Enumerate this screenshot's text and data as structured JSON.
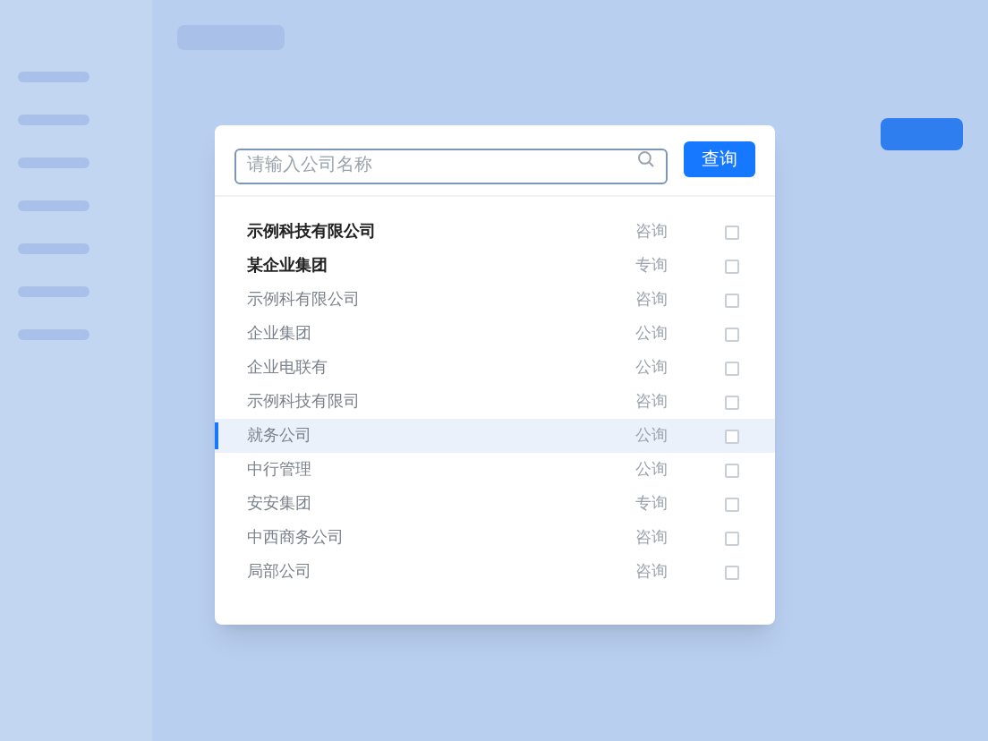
{
  "dialog": {
    "search": {
      "placeholder": "请输入公司名称"
    },
    "search_button": "查询",
    "rows": [
      {
        "name": "示例科技有限公司",
        "type": "咨询",
        "emphasized": true,
        "selected": false,
        "checked": false
      },
      {
        "name": "某企业集团",
        "type": "专询",
        "emphasized": true,
        "selected": false,
        "checked": false
      },
      {
        "name": "示例科有限公司",
        "type": "咨询",
        "emphasized": false,
        "selected": false,
        "checked": false
      },
      {
        "name": "企业集团",
        "type": "公询",
        "emphasized": false,
        "selected": false,
        "checked": false
      },
      {
        "name": "企业电联有",
        "type": "公询",
        "emphasized": false,
        "selected": false,
        "checked": false
      },
      {
        "name": "示例科技有限司",
        "type": "咨询",
        "emphasized": false,
        "selected": false,
        "checked": false
      },
      {
        "name": "就务公司",
        "type": "公询",
        "emphasized": false,
        "selected": true,
        "checked": false
      },
      {
        "name": "中行管理",
        "type": "公询",
        "emphasized": false,
        "selected": false,
        "checked": false
      },
      {
        "name": "安安集团",
        "type": "专询",
        "emphasized": false,
        "selected": false,
        "checked": false
      },
      {
        "name": "中西商务公司",
        "type": "咨询",
        "emphasized": false,
        "selected": false,
        "checked": false
      },
      {
        "name": "局部公司",
        "type": "咨询",
        "emphasized": false,
        "selected": false,
        "checked": false
      }
    ]
  }
}
